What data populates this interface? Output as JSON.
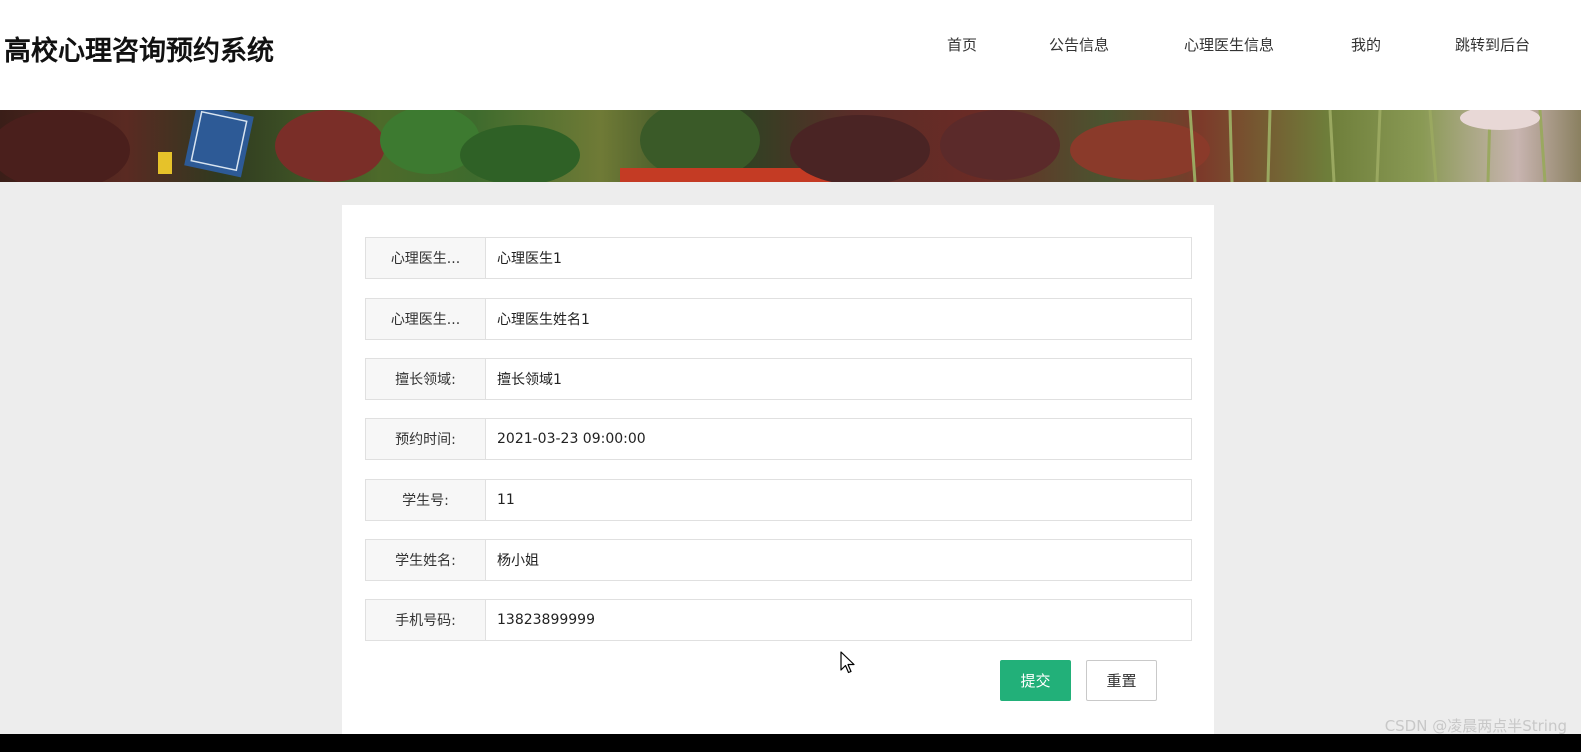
{
  "header": {
    "site_title": "高校心理咨询预约系统",
    "nav": [
      "首页",
      "公告信息",
      "心理医生信息",
      "我的",
      "跳转到后台"
    ]
  },
  "form": {
    "fields": [
      {
        "label": "心理医生...",
        "value": "心理医生1"
      },
      {
        "label": "心理医生...",
        "value": "心理医生姓名1"
      },
      {
        "label": "擅长领域:",
        "value": "擅长领域1"
      },
      {
        "label": "预约时间:",
        "value": "2021-03-23 09:00:00"
      },
      {
        "label": "学生号:",
        "value": "11"
      },
      {
        "label": "学生姓名:",
        "value": "杨小姐"
      },
      {
        "label": "手机号码:",
        "value": "13823899999"
      }
    ],
    "submit_label": "提交",
    "reset_label": "重置"
  },
  "watermark": "CSDN @凌晨两点半String",
  "colors": {
    "submit_button": "#22b079",
    "page_background": "#ededed"
  }
}
